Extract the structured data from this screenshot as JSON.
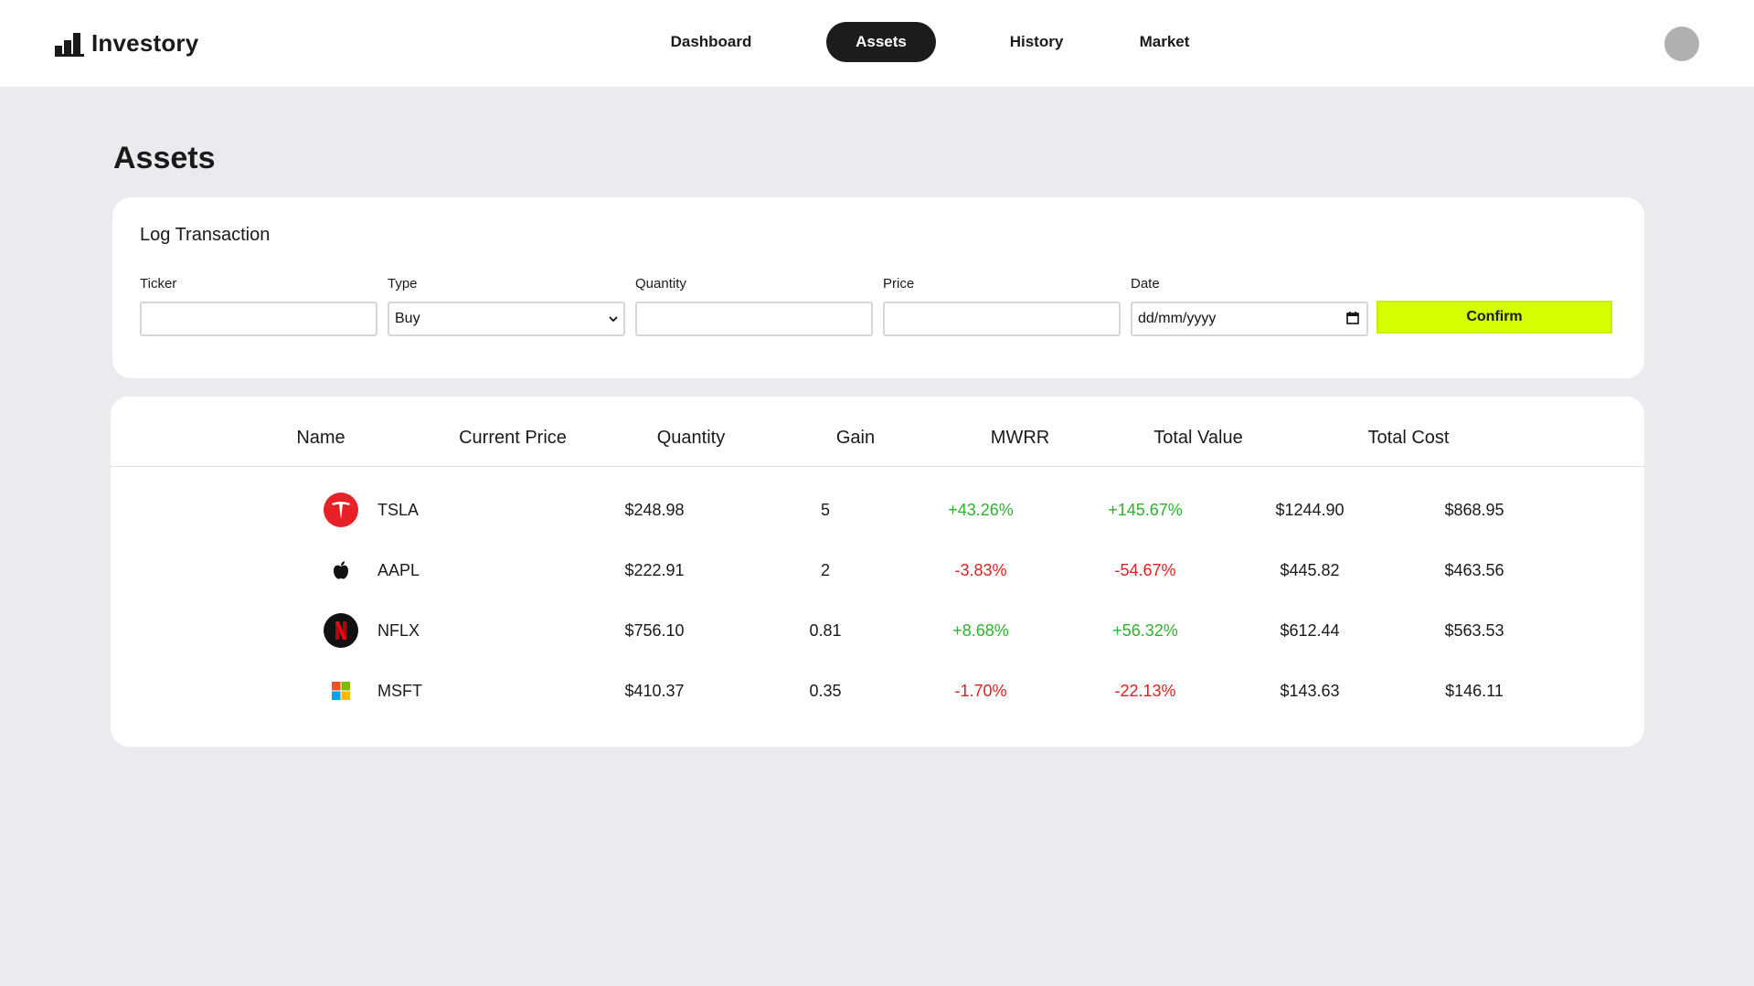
{
  "app": {
    "name": "Investory"
  },
  "nav": {
    "items": [
      {
        "label": "Dashboard",
        "active": false
      },
      {
        "label": "Assets",
        "active": true
      },
      {
        "label": "History",
        "active": false
      },
      {
        "label": "Market",
        "active": false
      }
    ]
  },
  "page": {
    "title": "Assets"
  },
  "transaction": {
    "title": "Log Transaction",
    "ticker": {
      "label": "Ticker",
      "value": ""
    },
    "type": {
      "label": "Type",
      "value": "Buy"
    },
    "quantity": {
      "label": "Quantity",
      "value": ""
    },
    "price": {
      "label": "Price",
      "value": ""
    },
    "date": {
      "label": "Date",
      "value": "dd/mm/yyyy"
    },
    "confirm_label": "Confirm"
  },
  "table": {
    "headers": [
      "Name",
      "Current Price",
      "Quantity",
      "Gain",
      "MWRR",
      "Total Value",
      "Total Cost"
    ],
    "rows": [
      {
        "ticker": "TSLA",
        "logo": "tesla-logo-icon",
        "price": "$248.98",
        "quantity": "5",
        "gain": "+43.26%",
        "mwrr": "+145.67%",
        "value": "$1244.90",
        "cost": "$868.95"
      },
      {
        "ticker": "AAPL",
        "logo": "apple-logo-icon",
        "price": "$222.91",
        "quantity": "2",
        "gain": "-3.83%",
        "mwrr": "-54.67%",
        "value": "$445.82",
        "cost": "$463.56"
      },
      {
        "ticker": "NFLX",
        "logo": "netflix-logo-icon",
        "price": "$756.10",
        "quantity": "0.81",
        "gain": "+8.68%",
        "mwrr": "+56.32%",
        "value": "$612.44",
        "cost": "$563.53"
      },
      {
        "ticker": "MSFT",
        "logo": "microsoft-logo-icon",
        "price": "$410.37",
        "quantity": "0.35",
        "gain": "-1.70%",
        "mwrr": "-22.13%",
        "value": "$143.63",
        "cost": "$146.11"
      }
    ]
  },
  "colors": {
    "accent": "#d6ff00",
    "positive": "#2bb32b",
    "negative": "#e02020",
    "nav_active": "#1c1c1c",
    "background": "#eaebef"
  }
}
